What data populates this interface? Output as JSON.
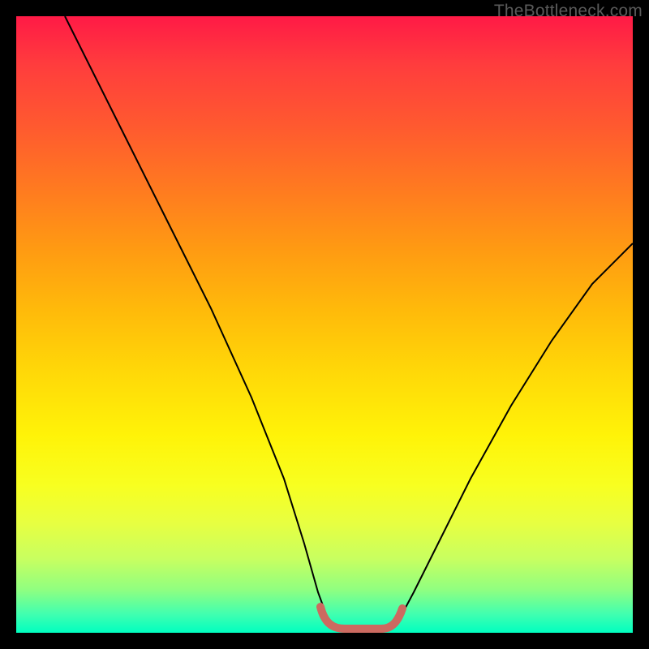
{
  "watermark": "TheBottleneck.com",
  "chart_data": {
    "type": "line",
    "title": "",
    "xlabel": "",
    "ylabel": "",
    "xlim": [
      0,
      100
    ],
    "ylim": [
      0,
      100
    ],
    "grid": false,
    "legend": false,
    "series": [
      {
        "name": "bottleneck-curve",
        "x": [
          0,
          5,
          10,
          15,
          20,
          25,
          30,
          35,
          40,
          45,
          48,
          50,
          52,
          55,
          58,
          60,
          65,
          70,
          75,
          80,
          85,
          90,
          95,
          100
        ],
        "values": [
          100,
          90,
          80,
          70,
          60,
          50,
          40,
          30,
          20,
          10,
          4,
          1,
          0,
          0,
          1,
          4,
          10,
          18,
          26,
          34,
          42,
          50,
          58,
          62
        ]
      }
    ],
    "annotations": [
      {
        "name": "optimal-range",
        "x_start": 46,
        "x_end": 60,
        "y": 0
      }
    ]
  }
}
